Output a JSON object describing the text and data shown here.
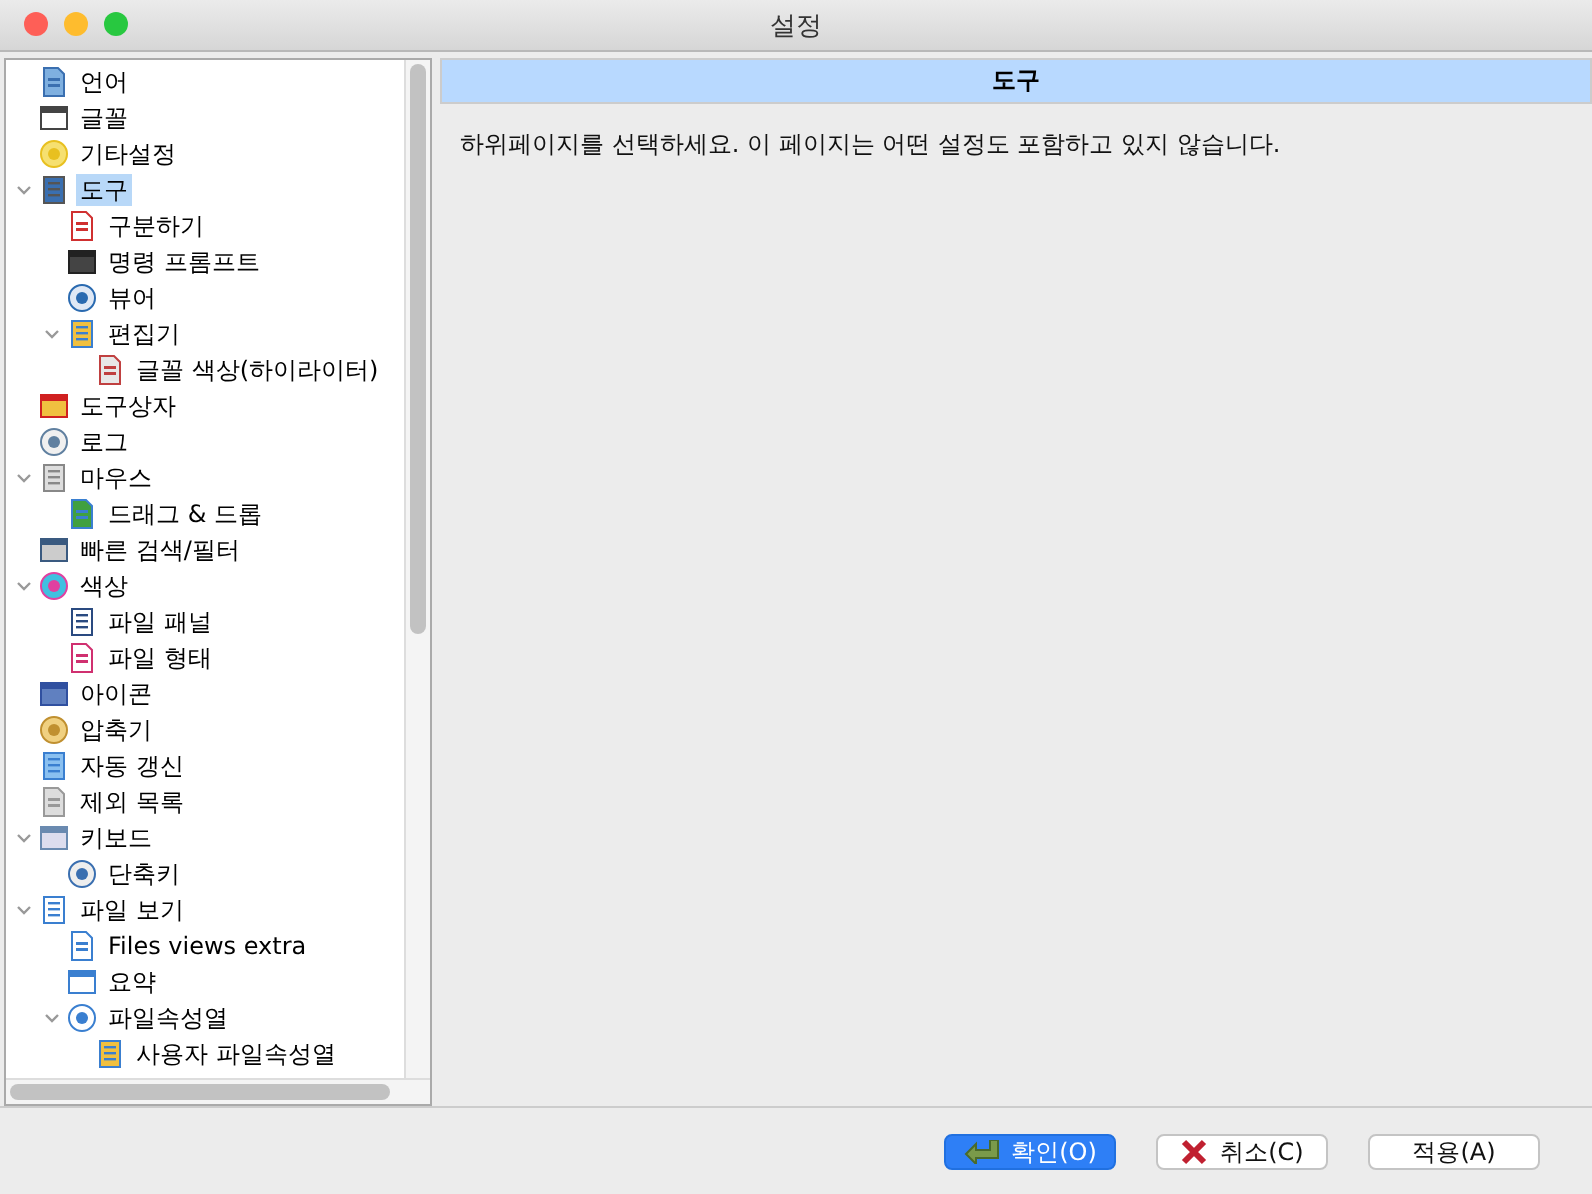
{
  "window": {
    "title": "설정"
  },
  "tree": [
    {
      "label": "언어",
      "selected": false
    },
    {
      "label": "글꼴",
      "selected": false
    },
    {
      "label": "기타설정",
      "selected": false
    },
    {
      "label": "도구",
      "selected": true,
      "expanded": true,
      "children": [
        {
          "label": "구분하기",
          "selected": false
        },
        {
          "label": "명령 프롬프트",
          "selected": false
        },
        {
          "label": "뷰어",
          "selected": false
        },
        {
          "label": "편집기",
          "selected": false,
          "expanded": true,
          "children": [
            {
              "label": "글꼴 색상(하이라이터)",
              "selected": false
            }
          ]
        }
      ]
    },
    {
      "label": "도구상자",
      "selected": false
    },
    {
      "label": "로그",
      "selected": false
    },
    {
      "label": "마우스",
      "selected": false,
      "expanded": true,
      "children": [
        {
          "label": "드래그 & 드롭",
          "selected": false
        }
      ]
    },
    {
      "label": "빠른 검색/필터",
      "selected": false
    },
    {
      "label": "색상",
      "selected": false,
      "expanded": true,
      "children": [
        {
          "label": "파일 패널",
          "selected": false
        },
        {
          "label": "파일 형태",
          "selected": false
        }
      ]
    },
    {
      "label": "아이콘",
      "selected": false
    },
    {
      "label": "압축기",
      "selected": false
    },
    {
      "label": "자동 갱신",
      "selected": false
    },
    {
      "label": "제외 목록",
      "selected": false
    },
    {
      "label": "키보드",
      "selected": false,
      "expanded": true,
      "children": [
        {
          "label": "단축키",
          "selected": false
        }
      ]
    },
    {
      "label": "파일 보기",
      "selected": false,
      "expanded": true,
      "children": [
        {
          "label": "Files views extra",
          "selected": false
        },
        {
          "label": "요약",
          "selected": false
        },
        {
          "label": "파일속성열",
          "selected": false,
          "expanded": true,
          "children": [
            {
              "label": "사용자 파일속성열",
              "selected": false
            }
          ]
        }
      ]
    }
  ],
  "page": {
    "title": "도구",
    "message": "하위페이지를 선택하세요. 이 페이지는 어떤 설정도 포함하고 있지 않습니다."
  },
  "buttons": [
    {
      "label": "확인(O)",
      "kind": "ok",
      "default": true
    },
    {
      "label": "취소(C)",
      "kind": "cancel",
      "default": false
    },
    {
      "label": "적용(A)",
      "kind": "plain",
      "default": false
    }
  ]
}
